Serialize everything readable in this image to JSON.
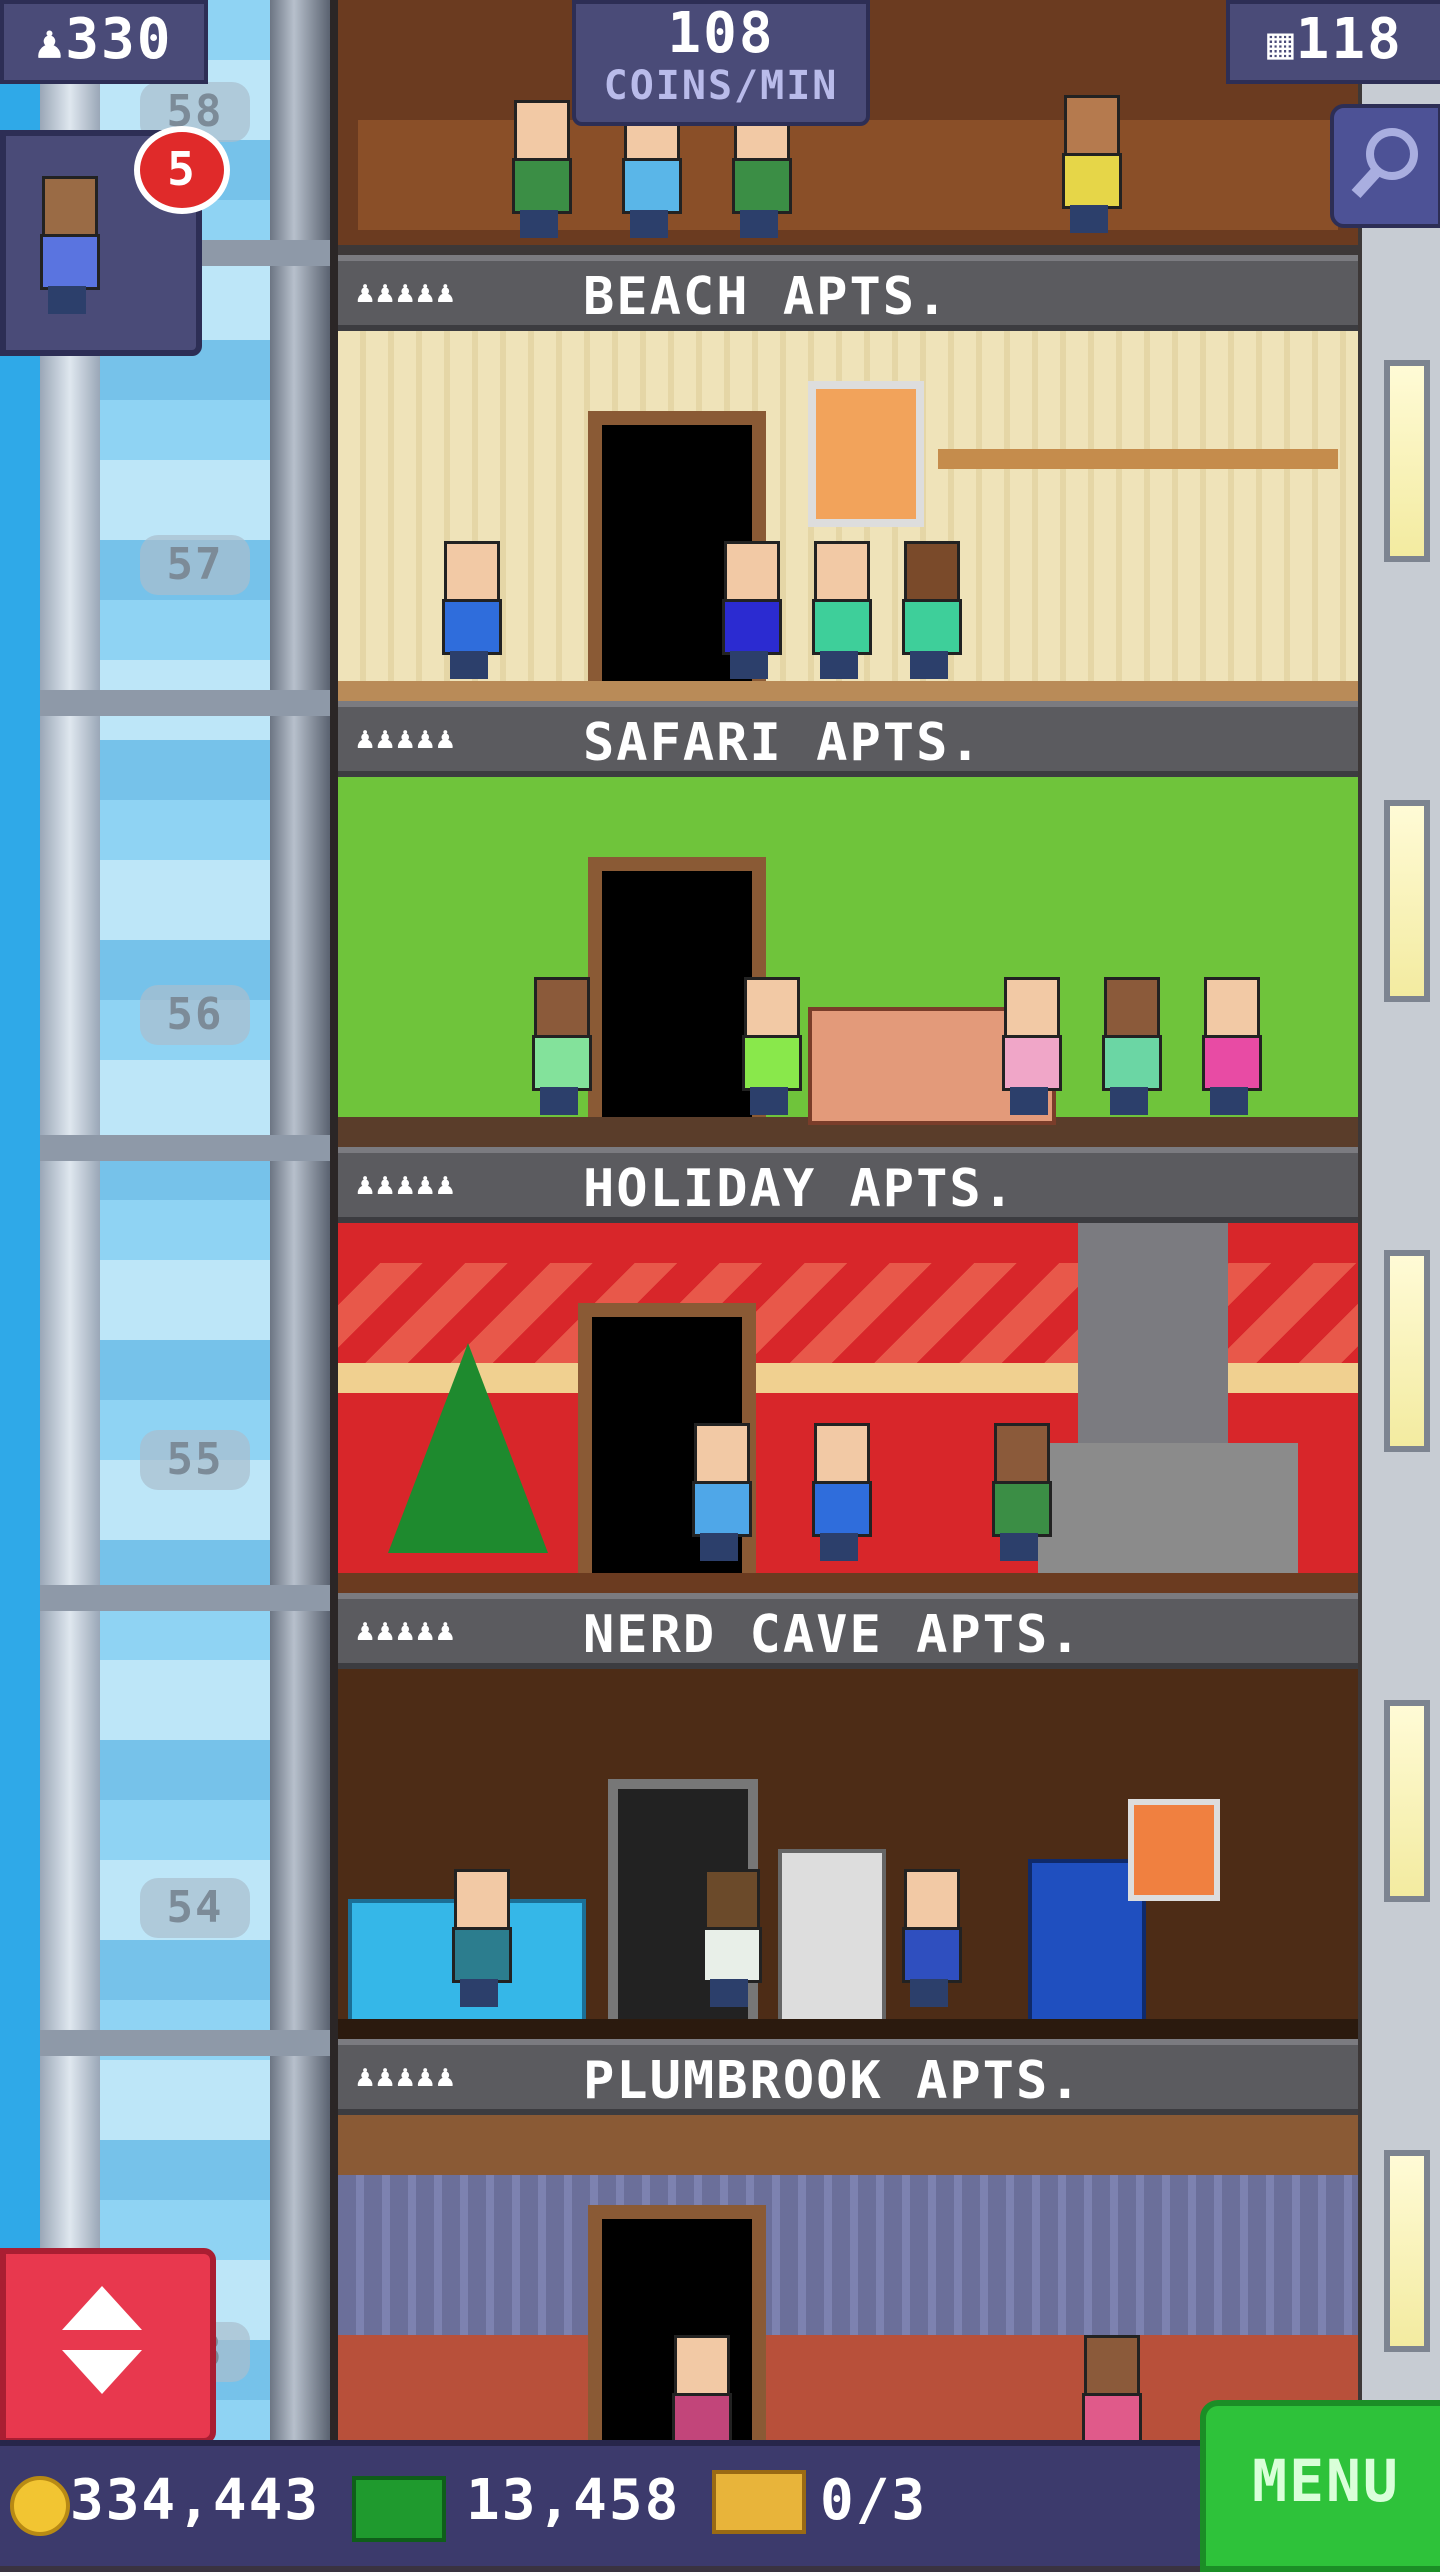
{
  "top": {
    "population": "330",
    "coins_rate_value": "108",
    "coins_rate_unit": "COINS/MIN",
    "floors": "118",
    "visitor_badge_count": "5"
  },
  "floors": [
    {
      "number": "57",
      "name": "BEACH APTS.",
      "residents_icon": "♟♟♟♟♟"
    },
    {
      "number": "56",
      "name": "SAFARI APTS.",
      "residents_icon": "♟♟♟♟♟"
    },
    {
      "number": "55",
      "name": "HOLIDAY APTS.",
      "residents_icon": "♟♟♟♟♟"
    },
    {
      "number": "54",
      "name": "NERD CAVE APTS.",
      "residents_icon": "♟♟♟♟♟"
    },
    {
      "number": "53",
      "name": "PLUMBROOK APTS.",
      "residents_icon": "♟♟♟♟♟"
    }
  ],
  "shaft_top_number": "58",
  "bottom": {
    "coins": "334,443",
    "bux": "13,458",
    "tickets": "0/3",
    "menu_label": "MENU"
  },
  "colors": {
    "beach_wall": "#efe3b9",
    "safari_wall": "#6fc43b",
    "holiday_wall": "#d8262a",
    "nerd_wall": "#4d2c16",
    "plumbrook_wall": "#6b6f9a",
    "menu_green": "#2ec23a",
    "updown_red": "#e8384e"
  },
  "icons": {
    "population": "person-icon",
    "floors": "building-icon",
    "zoom": "magnifier-icon",
    "coins": "coin-icon",
    "bux": "bux-icon",
    "tickets": "ticket-icon",
    "elevator": "up-down-arrow-icon"
  }
}
